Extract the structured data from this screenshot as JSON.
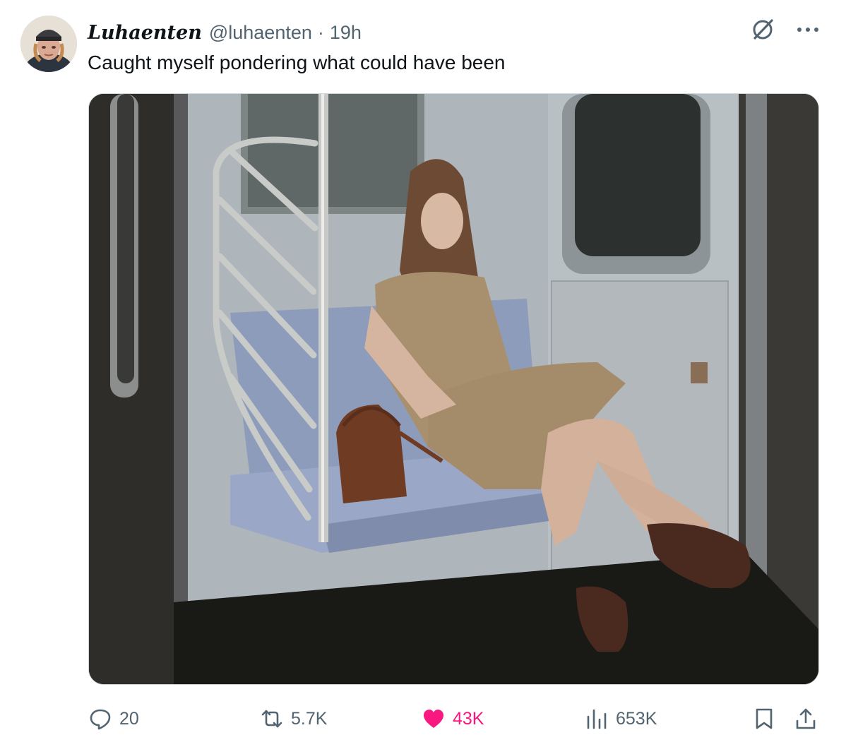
{
  "author": {
    "display_name": "Luhaenten",
    "handle": "@luhaenten",
    "time": "19h",
    "separator": "·"
  },
  "tweet": {
    "text": "Caught myself pondering what could have been"
  },
  "media": {
    "type": "photo"
  },
  "stats": {
    "replies": "20",
    "reposts": "5.7K",
    "likes": "43K",
    "views": "653K"
  },
  "colors": {
    "text": "#0f1419",
    "secondary": "#536471",
    "like_pink": "#f91880",
    "border": "#cfd9de"
  },
  "icons": {
    "header": [
      "grok-icon",
      "more-icon"
    ],
    "actions": [
      "reply-icon",
      "repost-icon",
      "like-icon",
      "views-icon",
      "bookmark-icon",
      "share-icon"
    ]
  }
}
